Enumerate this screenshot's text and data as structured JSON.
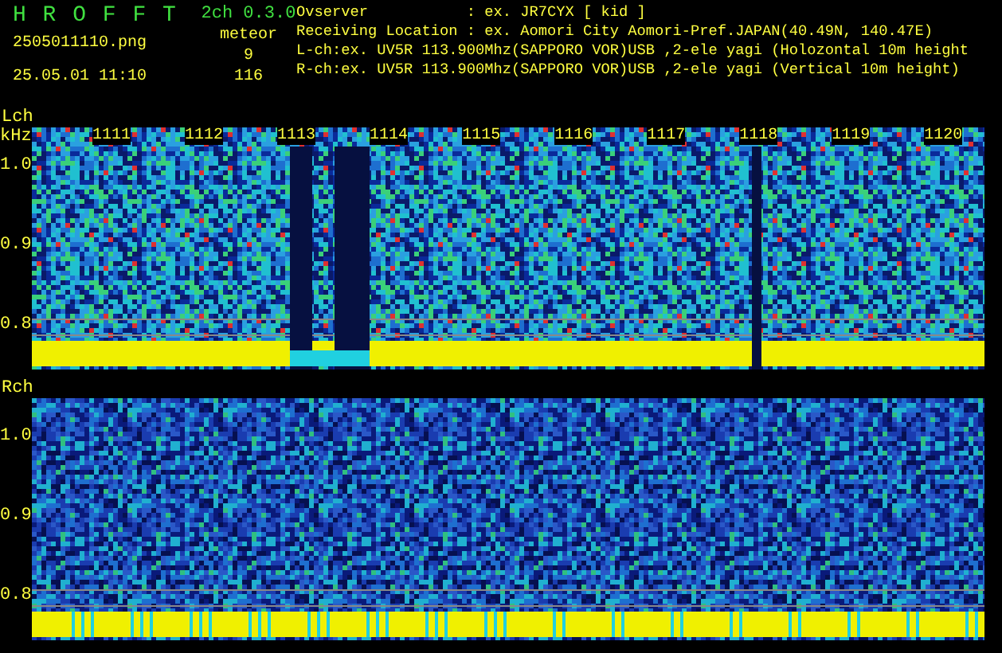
{
  "header": {
    "title": "H R O F F T",
    "version": "2ch 0.3.0",
    "filename": "2505011110.png",
    "timestamp": "25.05.01 11:10",
    "meteor_label": "meteor",
    "meteor_counts": [
      "9",
      "116"
    ]
  },
  "info_lines": [
    "Ovserver           : ex. JR7CYX [ kid ]",
    "Receiving Location : ex. Aomori City Aomori-Pref.JAPAN(40.49N, 140.47E)",
    "L-ch:ex. UV5R 113.900Mhz(SAPPORO VOR)USB ,2-ele yagi (Holozontal 10m height",
    "R-ch:ex. UV5R 113.900Mhz(SAPPORO VOR)USB ,2-ele yagi (Vertical 10m height)"
  ],
  "channels": [
    {
      "label": "Lch",
      "unit": "kHz",
      "time_marks": [
        "1111",
        "1112",
        "1113",
        "1114",
        "1115",
        "1116",
        "1117",
        "1118",
        "1119",
        "1120"
      ],
      "y_ticks": [
        "1.0",
        "0.9",
        "0.8"
      ],
      "kind": "bright"
    },
    {
      "label": "Rch",
      "y_ticks": [
        "1.0",
        "0.9",
        "0.8"
      ],
      "kind": "dim"
    }
  ]
}
